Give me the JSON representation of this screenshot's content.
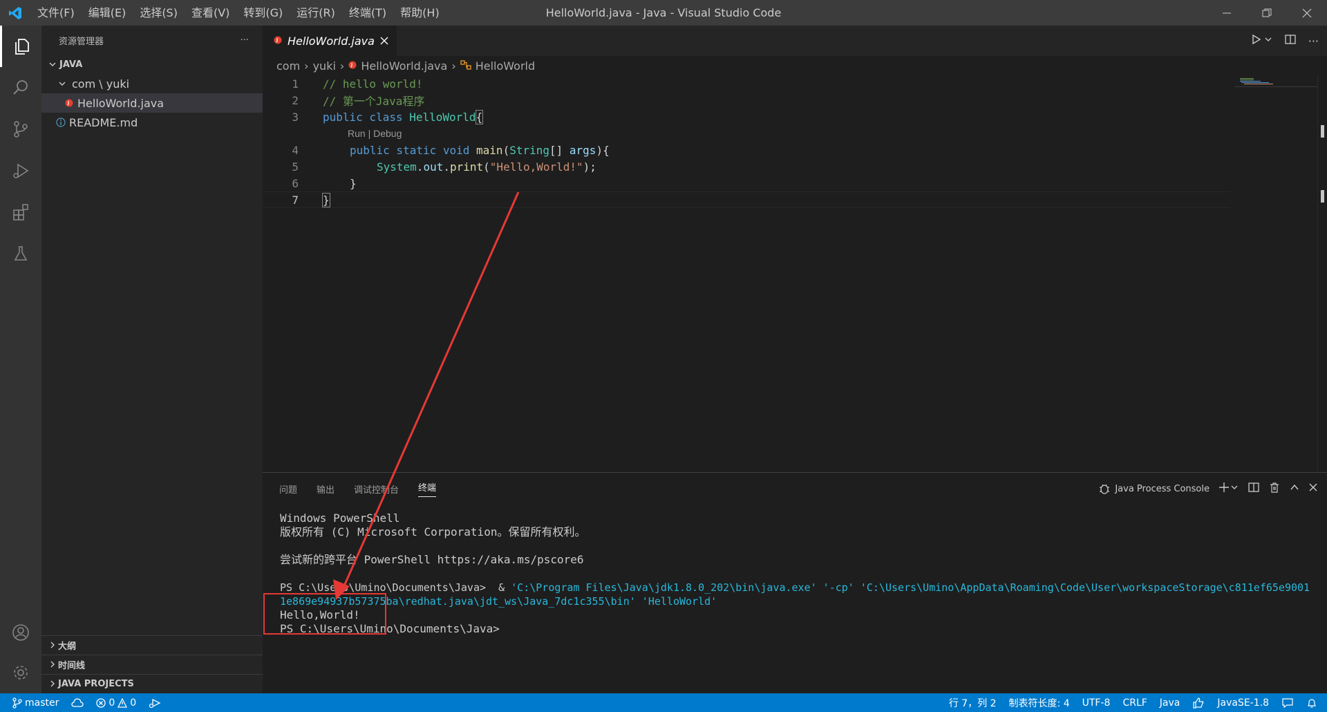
{
  "titlebar": {
    "menu": [
      "文件(F)",
      "编辑(E)",
      "选择(S)",
      "查看(V)",
      "转到(G)",
      "运行(R)",
      "终端(T)",
      "帮助(H)"
    ],
    "title": "HelloWorld.java - Java - Visual Studio Code"
  },
  "sidebar": {
    "title": "资源管理器",
    "more": "···",
    "root": "JAVA",
    "folder": "com \\ yuki",
    "file_selected": "HelloWorld.java",
    "file_readme": "README.md",
    "sections": [
      "大纲",
      "时间线",
      "JAVA PROJECTS"
    ]
  },
  "editor": {
    "tab_label": "HelloWorld.java",
    "breadcrumb": [
      "com",
      "yuki",
      "HelloWorld.java",
      "HelloWorld"
    ],
    "codelens": "Run | Debug",
    "line_numbers": [
      "1",
      "2",
      "3",
      "4",
      "5",
      "6",
      "7"
    ],
    "code": {
      "l1": "// hello world!",
      "l2": "// 第一个Java程序",
      "l3_kw": "public class ",
      "l3_name": "HelloWorld",
      "l3_rest": "{",
      "l4_kw1": "public static void ",
      "l4_fn": "main",
      "l4_p1": "(",
      "l4_ty": "String",
      "l4_p2": "[] ",
      "l4_pa": "args",
      "l4_p3": "){",
      "l5_ty": "System",
      "l5_p1": ".",
      "l5_pa": "out",
      "l5_p2": ".",
      "l5_fn": "print",
      "l5_p3": "(",
      "l5_st": "\"Hello,World!\"",
      "l5_p4": ");",
      "l6": "}",
      "l7": "}"
    }
  },
  "panel": {
    "tabs": [
      "问题",
      "输出",
      "调试控制台",
      "终端"
    ],
    "active_tab": "终端",
    "terminal_select": "Java Process Console",
    "terminal": {
      "t1": "Windows PowerShell",
      "t2": "版权所有 (C) Microsoft Corporation。保留所有权利。",
      "t3": "尝试新的跨平台 PowerShell https://aka.ms/pscore6",
      "t4_prompt": "PS C:\\Users\\Umino\\Documents\\Java>  & ",
      "t4_cmd": "'C:\\Program Files\\Java\\jdk1.8.0_202\\bin\\java.exe' '-cp' 'C:\\Users\\Umino\\AppData\\Roaming\\Code\\User\\workspaceStorage\\c811ef65e9001",
      "t5_cmd": "1e869e94937b57375ba\\redhat.java\\jdt_ws\\Java_7dc1c355\\bin' 'HelloWorld'",
      "t6": "Hello,World!",
      "t7": "PS C:\\Users\\Umino\\Documents\\Java>"
    }
  },
  "statusbar": {
    "branch": "master",
    "errors": "0",
    "warnings": "0",
    "position": "行 7，列 2",
    "tab_size": "制表符长度: 4",
    "encoding": "UTF-8",
    "eol": "CRLF",
    "language": "Java",
    "jdk": "JavaSE-1.8"
  },
  "colors": {
    "accent": "#007acc",
    "annotation": "#e53935",
    "java_icon": "#e2412e"
  }
}
